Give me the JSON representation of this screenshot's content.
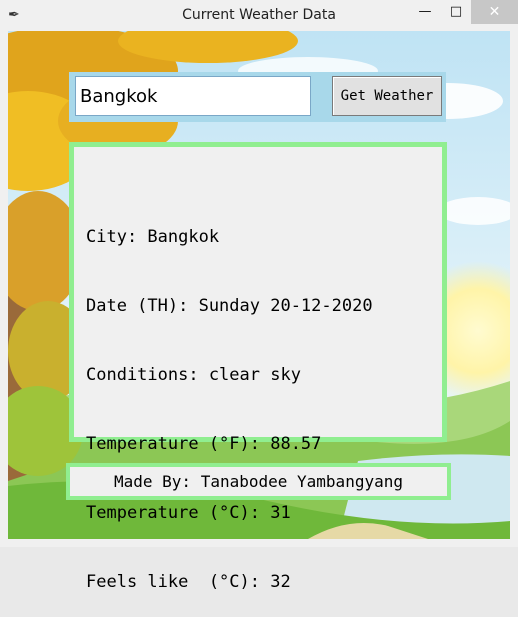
{
  "window": {
    "title": "Current Weather Data",
    "icon": "feather-icon",
    "minimize": "—",
    "maximize": "□",
    "close": "✕"
  },
  "search": {
    "value": "Bangkok",
    "button_label": "Get Weather"
  },
  "result": {
    "lines": [
      "City: Bangkok",
      "Date (TH): Sunday 20-12-2020",
      "Conditions: clear sky",
      "Temperature (°F): 88.57",
      "Temperature (°C): 31",
      "Feels like  (°C): 32"
    ]
  },
  "footer": {
    "text": "Made By: Tanabodee Yambangyang"
  },
  "colors": {
    "panel_border": "#90ee90",
    "search_bg": "#a8d8ea",
    "sky": "#cfe9f5",
    "grass": "#7cc242"
  }
}
